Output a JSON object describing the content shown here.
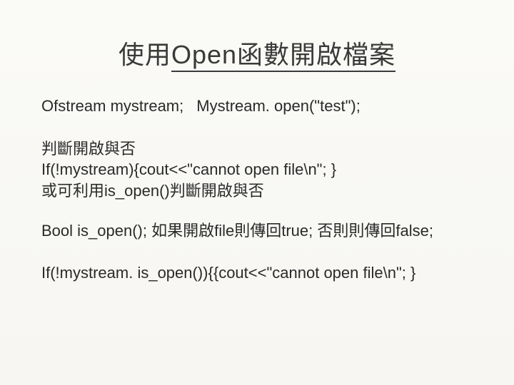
{
  "title_prefix": "使用",
  "title_underline": "Open函數開啟檔案",
  "line1_a": "Ofstream mystream;",
  "line1_b": "Mystream. open(\"test\");",
  "block2_line1": "判斷開啟與否",
  "block2_line2": "If(!mystream){cout<<\"cannot open file\\n\"; }",
  "block2_line3": "或可利用is_open()判斷開啟與否",
  "line3": "Bool is_open(); 如果開啟file則傳回true; 否則則傳回false;",
  "line4": "If(!mystream. is_open()){{cout<<\"cannot open file\\n\"; }"
}
